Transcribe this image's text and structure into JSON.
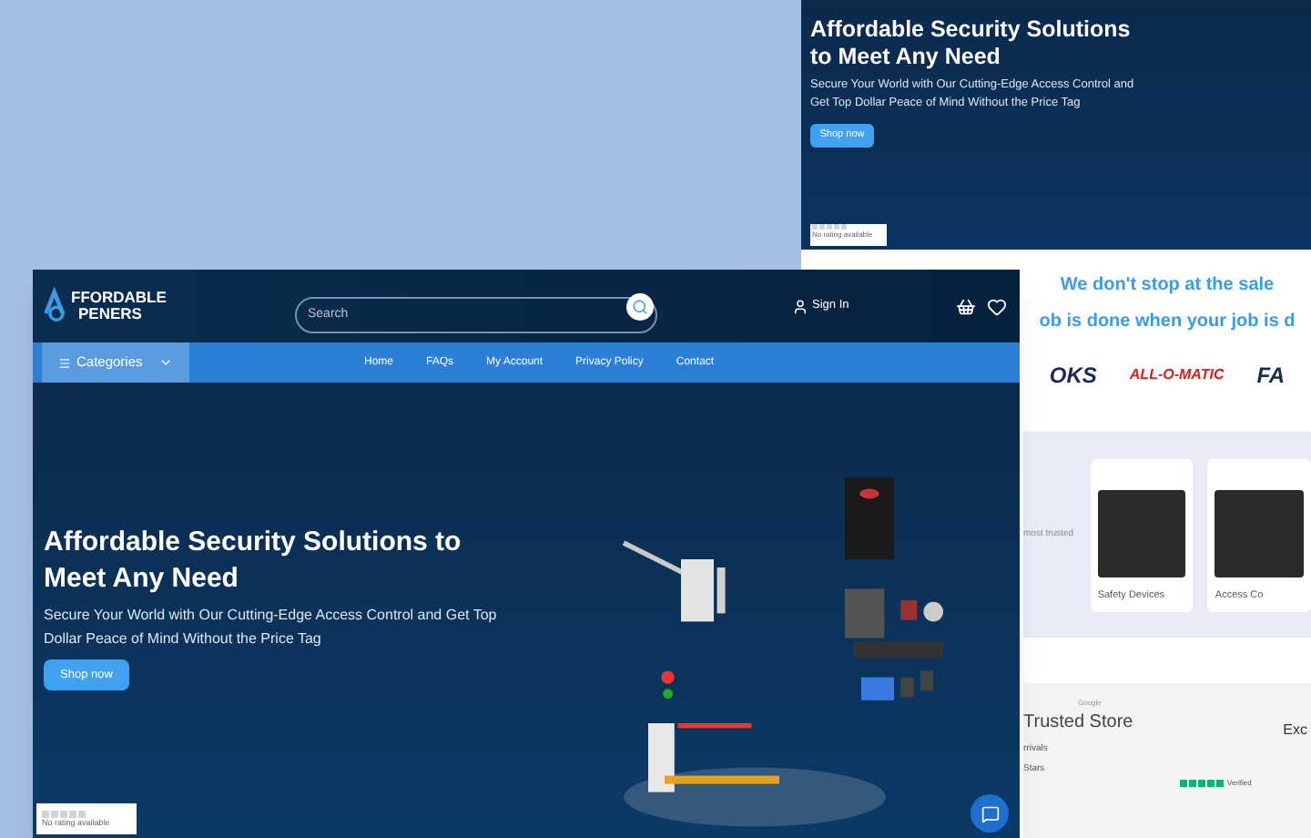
{
  "back_page": {
    "hero": {
      "title": "Affordable Security Solutions to Meet Any Need",
      "subtitle": "Secure Your World with Our Cutting-Edge Access Control and Get Top Dollar Peace of Mind Without the Price Tag",
      "button": "Shop now",
      "rating_badge": {
        "stars": 0,
        "text": "No rating available"
      }
    },
    "tagline": [
      "We don't stop at the sale",
      "ob is done when your job is d"
    ],
    "brand_logos": [
      "OKS",
      "ALL-O-MATIC",
      "FA"
    ],
    "categories_intro": "most trusted",
    "category_cards": [
      {
        "label": "Safety Devices"
      },
      {
        "label": "Access Co"
      }
    ],
    "reviews": {
      "google_label": "Google",
      "store": "Trusted Store",
      "heading": "Exc",
      "verified": "Verified",
      "links": [
        "rrivals",
        "Stars"
      ]
    }
  },
  "front_page": {
    "header": {
      "logo_top": "FFORDABLE",
      "logo_bottom": "PENERS",
      "search": {
        "placeholder": "Search"
      },
      "sign_in": "Sign In"
    },
    "categories_button": "Categories",
    "nav": [
      {
        "label": "Home"
      },
      {
        "label": "FAQs"
      },
      {
        "label": "My Account"
      },
      {
        "label": "Privacy Policy"
      },
      {
        "label": "Contact"
      }
    ],
    "hero": {
      "title": "Affordable Security Solutions to Meet Any Need",
      "subtitle": "Secure Your World with Our Cutting-Edge Access Control and Get Top Dollar Peace of Mind Without the Price Tag",
      "button": "Shop now",
      "rating_badge": {
        "stars": 0,
        "text": "No rating available"
      }
    }
  }
}
